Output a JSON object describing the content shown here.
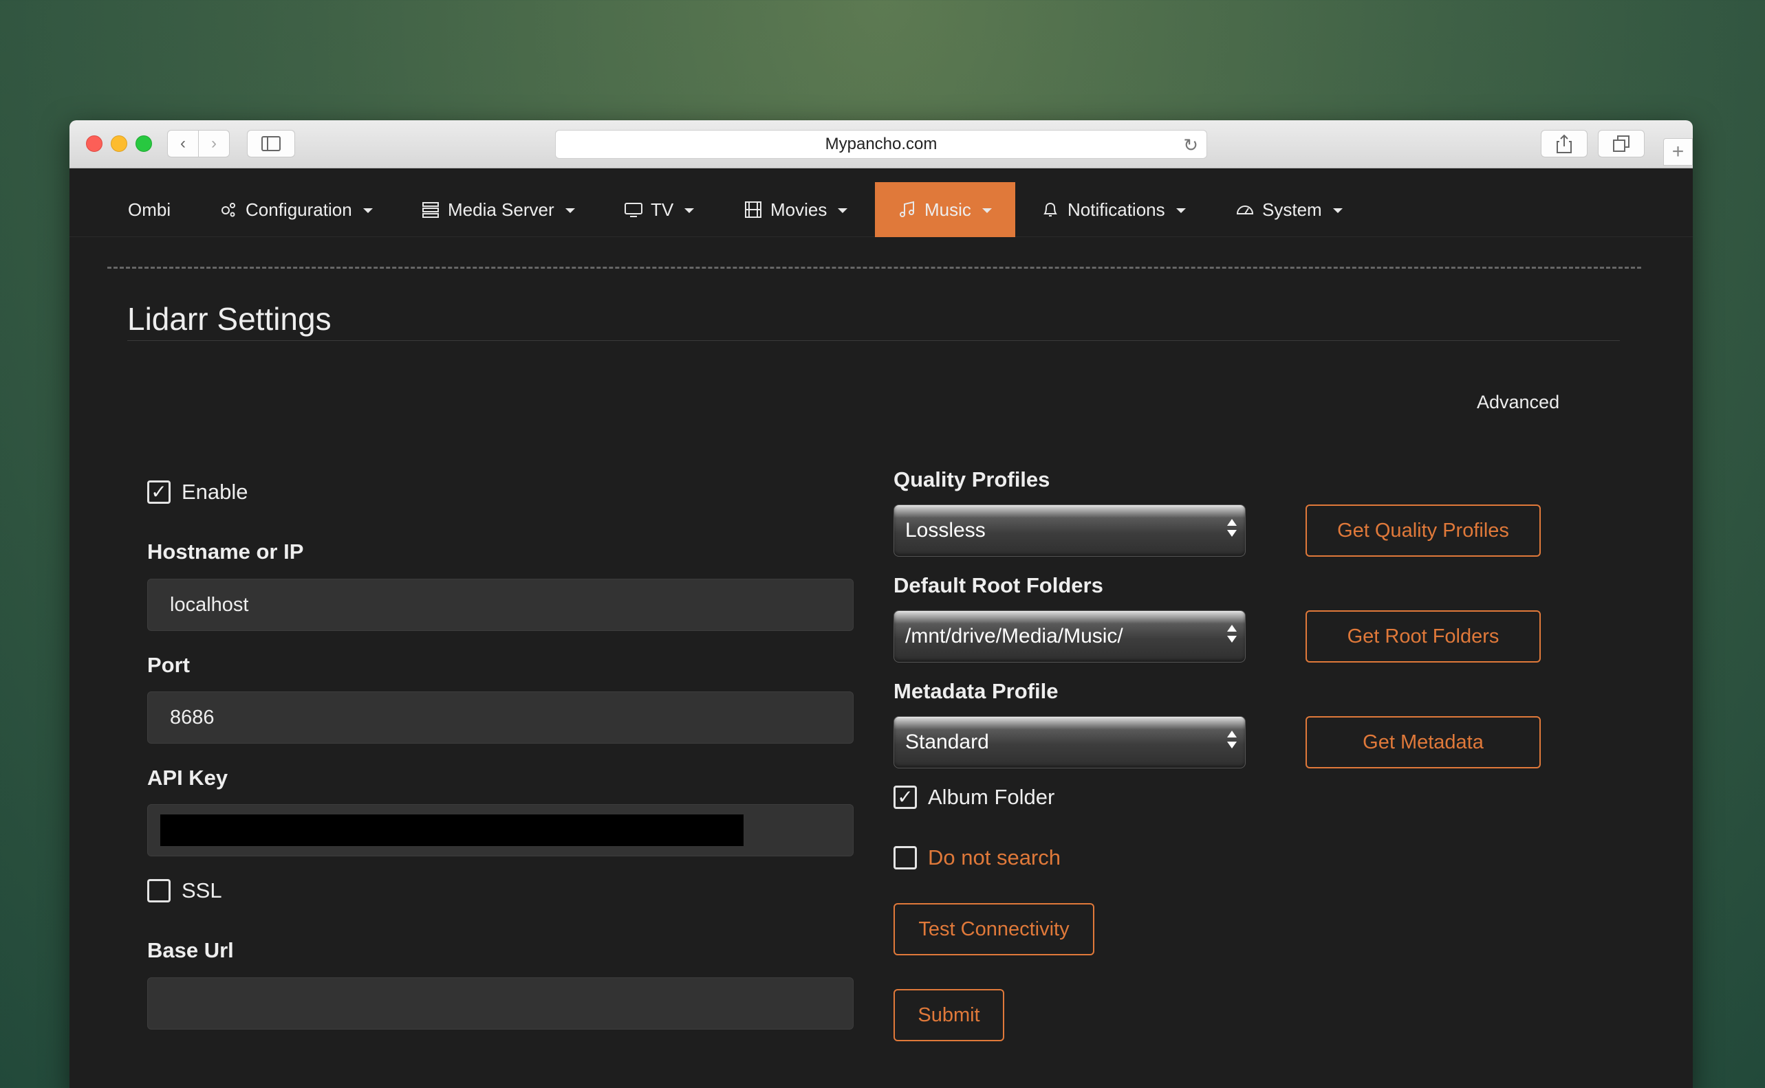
{
  "browser": {
    "url": "Mypancho.com"
  },
  "nav": {
    "brand": "Ombi",
    "items": [
      {
        "label": "Configuration",
        "icon": "cogs-icon"
      },
      {
        "label": "Media Server",
        "icon": "server-icon"
      },
      {
        "label": "TV",
        "icon": "tv-icon"
      },
      {
        "label": "Movies",
        "icon": "film-icon"
      },
      {
        "label": "Music",
        "icon": "music-icon",
        "active": true
      },
      {
        "label": "Notifications",
        "icon": "bell-icon"
      },
      {
        "label": "System",
        "icon": "dashboard-icon"
      }
    ]
  },
  "page": {
    "title": "Lidarr Settings",
    "advanced": "Advanced"
  },
  "form": {
    "enable_label": "Enable",
    "enable_checked": true,
    "hostname_label": "Hostname or IP",
    "hostname_value": "localhost",
    "port_label": "Port",
    "port_value": "8686",
    "apikey_label": "API Key",
    "ssl_label": "SSL",
    "ssl_checked": false,
    "baseurl_label": "Base Url",
    "baseurl_value": "",
    "quality_label": "Quality Profiles",
    "quality_value": "Lossless",
    "quality_button": "Get Quality Profiles",
    "root_label": "Default Root Folders",
    "root_value": "/mnt/drive/Media/Music/",
    "root_button": "Get Root Folders",
    "metadata_label": "Metadata Profile",
    "metadata_value": "Standard",
    "metadata_button": "Get Metadata",
    "album_folder_label": "Album Folder",
    "album_folder_checked": true,
    "do_not_search_label": "Do not search",
    "do_not_search_checked": false,
    "test_button": "Test Connectivity",
    "submit_button": "Submit"
  },
  "colors": {
    "accent": "#e0793a",
    "background": "#1e1e1e",
    "input": "#333333"
  }
}
